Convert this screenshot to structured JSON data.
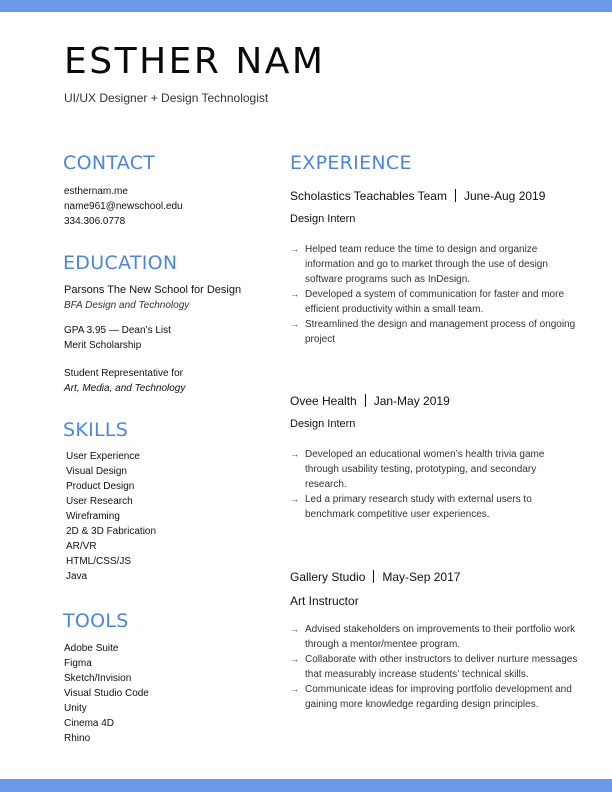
{
  "header": {
    "name": "ESTHER NAM",
    "tagline": "UI/UX Designer + Design Technologist"
  },
  "contact": {
    "heading": "CONTACT",
    "website": "esthernam.me",
    "email": "name961@newschool.edu",
    "phone": "334.306.0778"
  },
  "education": {
    "heading": "EDUCATION",
    "school": "Parsons The New School for Design",
    "degree": "BFA Design and Technology",
    "gpa": "GPA 3.95 — Dean’s List",
    "scholarship": "Merit Scholarship",
    "rep_line1": "Student Representative for",
    "rep_line2": "Art, Media, and Technology"
  },
  "skills": {
    "heading": "SKILLS",
    "items": [
      "User Experience",
      "Visual Design",
      "Product Design",
      "User Research",
      "Wireframing",
      "2D & 3D Fabrication",
      "AR/VR",
      "HTML/CSS/JS",
      "Java"
    ]
  },
  "tools": {
    "heading": "TOOLS",
    "items": [
      "Adobe Suite",
      "Figma",
      "Sketch/Invision",
      "Visual Studio Code",
      "Unity",
      "Cinema 4D",
      "Rhino"
    ]
  },
  "experience": {
    "heading": "EXPERIENCE",
    "jobs": [
      {
        "company": "Scholastics Teachables Team",
        "dates": "June-Aug 2019",
        "role": "Design Intern",
        "bullets": [
          "Helped team reduce the time to design and organize information and go to market through the use of design software programs such as InDesign.",
          "Developed a system of communication for faster and more efficient  productivity within a small team.",
          "Streamlined the design and management process of ongoing project"
        ]
      },
      {
        "company": "Ovee Health",
        "dates": "Jan-May 2019",
        "role": "Design Intern",
        "bullets": [
          "Developed an educational women’s health trivia game through usability testing, prototyping, and secondary research.",
          "Led a primary research study with external users to benchmark competitive user experiences."
        ]
      },
      {
        "company": "Gallery Studio",
        "dates": "May-Sep 2017",
        "role": "Art Instructor",
        "bullets": [
          "Advised stakeholders on improvements to their portfolio work through a mentor/mentee program.",
          "Collaborate with other instructors to deliver nurture messages that measurably increase students’ technical skills.",
          "Communicate ideas for improving portfolio development and gaining more knowledge regarding design principles."
        ]
      }
    ]
  },
  "icons": {
    "bullet": "arrow-right-icon"
  },
  "colors": {
    "accent": "#4a86e0",
    "bar": "#6b9be8"
  }
}
